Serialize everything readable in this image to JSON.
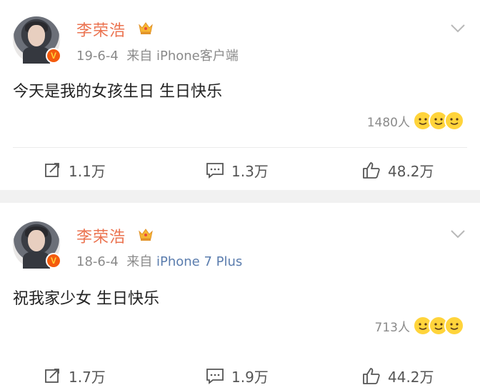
{
  "posts": [
    {
      "user": "李荣浩",
      "date": "19-6-4",
      "source_prefix": "来自",
      "source": "iPhone客户端",
      "content": "今天是我的女孩生日 生日快乐",
      "reaction_count": "1480人",
      "repost": "1.1万",
      "comments": "1.3万",
      "likes": "48.2万"
    },
    {
      "user": "李荣浩",
      "date": "18-6-4",
      "source_prefix": "来自",
      "source": "iPhone 7 Plus",
      "content": "祝我家少女 生日快乐",
      "reaction_count": "713人",
      "repost": "1.7万",
      "comments": "1.9万",
      "likes": "44.2万"
    }
  ],
  "icons": {
    "crown": "crown-icon",
    "verified": "verified-v-icon",
    "more": "chevron-down-icon",
    "repost": "repost-icon",
    "comment": "comment-icon",
    "like": "thumbs-up-icon"
  },
  "colors": {
    "username": "#eb7350",
    "meta": "#8a8a8a",
    "source_link": "#5b7dae",
    "separator": "#f1f1f1"
  }
}
